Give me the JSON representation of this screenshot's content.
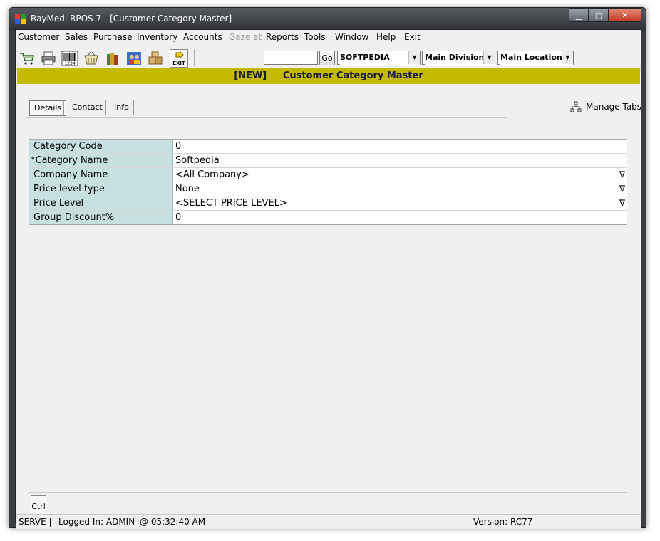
{
  "window": {
    "title": "RayMedi RPOS 7 - [Customer Category Master]",
    "controls": {
      "minimize": "▁",
      "maximize": "▢",
      "close": "✕"
    }
  },
  "menu": [
    {
      "label": "Customer",
      "enabled": true
    },
    {
      "label": "Sales",
      "enabled": true
    },
    {
      "label": "Purchase",
      "enabled": true
    },
    {
      "label": "Inventory",
      "enabled": true
    },
    {
      "label": "Accounts",
      "enabled": true
    },
    {
      "label": "Gaze at",
      "enabled": false
    },
    {
      "label": "Reports",
      "enabled": true
    },
    {
      "label": "Tools",
      "enabled": true
    },
    {
      "label": "Window",
      "enabled": true
    },
    {
      "label": "Help",
      "enabled": true
    },
    {
      "label": "Exit",
      "enabled": true
    }
  ],
  "toolbar": {
    "icons": [
      "cart-icon",
      "printer-icon",
      "barcode-icon",
      "basket-icon",
      "books-icon",
      "people-icon",
      "boxes-icon",
      "exit-icon"
    ],
    "barcode_text": "1234",
    "exit_text": "EXIT",
    "search_value": "",
    "go_label": "Go",
    "company_value": "SOFTPEDIA",
    "division_value": "Main Division",
    "location_value": "Main Location"
  },
  "header": {
    "status": "[NEW]",
    "title": "Customer Category Master",
    "color": "#c4ba00"
  },
  "tabs": [
    {
      "label": "Details",
      "active": true
    },
    {
      "label": "Contact",
      "active": false
    },
    {
      "label": "Info",
      "active": false
    }
  ],
  "manage_tabs_label": "Manage Tabs",
  "form": {
    "label_color": "#c6e1df",
    "fields": [
      {
        "label": "Category Code",
        "value": "0",
        "required": false,
        "dropdown": false
      },
      {
        "label": "*Category Name",
        "value": "Softpedia",
        "required": true,
        "dropdown": false
      },
      {
        "label": "Company Name",
        "value": "<All Company>",
        "required": false,
        "dropdown": true
      },
      {
        "label": "Price level type",
        "value": "None",
        "required": false,
        "dropdown": true
      },
      {
        "label": "Price Level",
        "value": "<SELECT PRICE LEVEL>",
        "required": false,
        "dropdown": true
      },
      {
        "label": "Group Discount%",
        "value": "0",
        "required": false,
        "dropdown": false
      }
    ],
    "dropdown_glyph": "∇"
  },
  "bottom_tab": "Ctrl",
  "statusbar": {
    "server": "SERVE |",
    "logged_in": "Logged In: ADMIN",
    "time": "@ 05:32:40 AM",
    "version": "Version: RC77"
  }
}
